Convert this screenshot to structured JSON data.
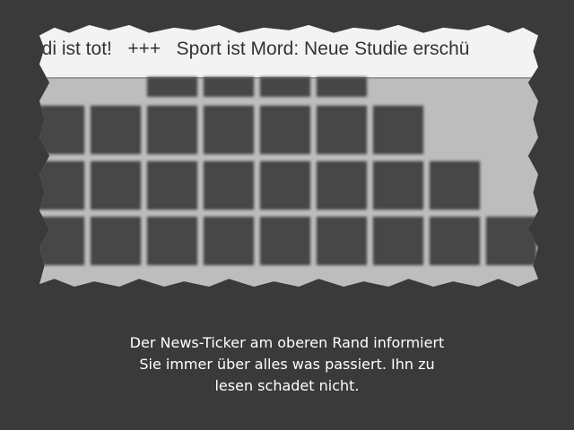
{
  "ticker": {
    "text": "ldi ist tot!   +++   Sport ist Mord: Neue Studie erschü"
  },
  "caption": {
    "line1": "Der News-Ticker am oberen Rand informiert",
    "line2": "Sie immer über alles was passiert. Ihn zu",
    "line3": "lesen schadet nicht."
  },
  "colors": {
    "background": "#3a3a3a",
    "ticker_background": "#f3f3f3",
    "board_background": "#bdbdbd",
    "tile": "#474747",
    "caption_text": "#ffffff"
  }
}
